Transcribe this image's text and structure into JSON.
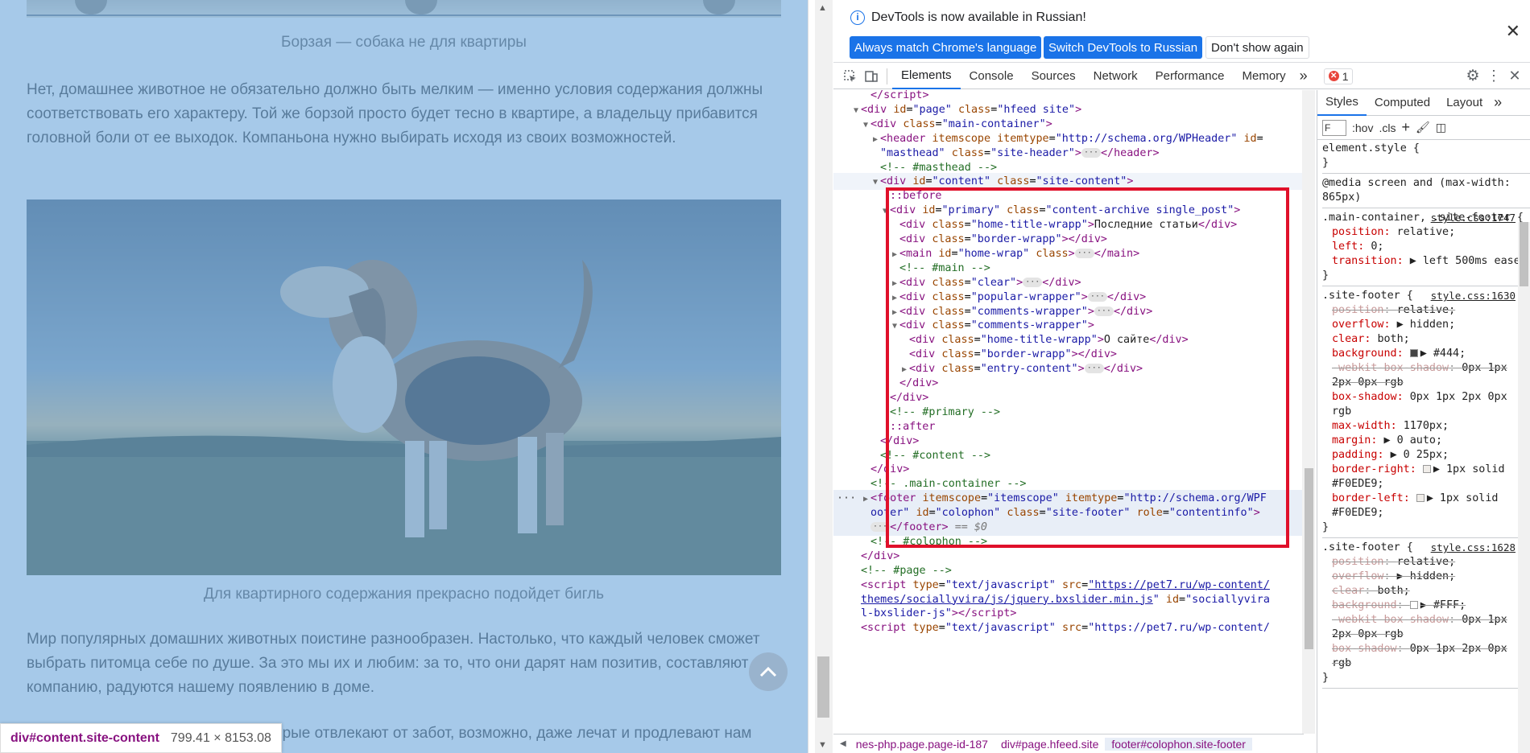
{
  "page": {
    "caption1": "Борзая — собака не для квартиры",
    "para1": "Нет, домашнее животное не обязательно должно быть мелким — именно условия содержания должны соответствовать его характеру. Той же борзой просто будет тесно в квартире, а владельцу прибавится головной боли от ее выходок. Компаньона нужно выбирать исходя из своих возможностей.",
    "caption2": "Для квартирного содержания прекрасно подойдет бигль",
    "para2": "Мир популярных домашних животных поистине разнообразен. Настолько, что каждый человек сможет выбрать питомца себе по душе. За это мы их и любим: за то, что они дарят нам позитив, составляют компанию, радуются нашему появлению в доме.",
    "para3_partial": "орые отвлекают от забот, возможно, даже лечат и продлевают нам",
    "tooltip_selector": "div#content.site-content",
    "tooltip_dims": "799.41 × 8153.08",
    "scroll_top_icon": "chevron-up-icon"
  },
  "infobar": {
    "message": "DevTools is now available in Russian!",
    "btn_match": "Always match Chrome's language",
    "btn_switch": "Switch DevTools to Russian",
    "btn_dismiss": "Don't show again",
    "close": "✕"
  },
  "tabs": [
    "Elements",
    "Console",
    "Sources",
    "Network",
    "Performance",
    "Memory"
  ],
  "more_tabs": "»",
  "error_count": "1",
  "elements_lines": [
    {
      "indent": 3,
      "html": "<span class='tag'>&lt;/script&gt;</span>"
    },
    {
      "indent": 2,
      "tri": "▼",
      "html": "<span class='tag'>&lt;div</span> <span class='attr'>id</span>=<span class='val'>\"page\"</span> <span class='attr'>class</span>=<span class='val'>\"hfeed site\"</span><span class='tag'>&gt;</span>"
    },
    {
      "indent": 3,
      "tri": "▼",
      "html": "<span class='tag'>&lt;div</span> <span class='attr'>class</span>=<span class='val'>\"main-container\"</span><span class='tag'>&gt;</span>"
    },
    {
      "indent": 4,
      "tri": "▶",
      "html": "<span class='tag'>&lt;header</span> <span class='attr'>itemscope</span> <span class='attr'>itemtype</span>=<span class='val'>\"http://schema.org/WPHeader\"</span> <span class='attr'>id</span>="
    },
    {
      "indent": 4,
      "html": "<span class='val'>\"masthead\"</span> <span class='attr'>class</span>=<span class='val'>\"site-header\"</span><span class='tag'>&gt;</span><span class='ell'>···</span><span class='tag'>&lt;/header&gt;</span>"
    },
    {
      "indent": 4,
      "html": "<span class='comment'>&lt;!-- #masthead --&gt;</span>"
    },
    {
      "indent": 4,
      "tri": "▼",
      "cls": "hov",
      "html": "<span class='tag'>&lt;div</span> <span class='attr'>id</span>=<span class='val'>\"content\"</span> <span class='attr'>class</span>=<span class='val'>\"site-content\"</span><span class='tag'>&gt;</span>"
    },
    {
      "indent": 5,
      "html": "<span class='pseudo'>::before</span>"
    },
    {
      "indent": 5,
      "tri": "▼",
      "html": "<span class='tag'>&lt;div</span> <span class='attr'>id</span>=<span class='val'>\"primary\"</span> <span class='attr'>class</span>=<span class='val'>\"content-archive single_post\"</span><span class='tag'>&gt;</span>"
    },
    {
      "indent": 6,
      "html": "<span class='tag'>&lt;div</span> <span class='attr'>class</span>=<span class='val'>\"home-title-wrapp\"</span><span class='tag'>&gt;</span><span class='txt'>Последние статьи</span><span class='tag'>&lt;/div&gt;</span>"
    },
    {
      "indent": 6,
      "html": "<span class='tag'>&lt;div</span> <span class='attr'>class</span>=<span class='val'>\"border-wrapp\"</span><span class='tag'>&gt;&lt;/div&gt;</span>"
    },
    {
      "indent": 6,
      "tri": "▶",
      "html": "<span class='tag'>&lt;main</span> <span class='attr'>id</span>=<span class='val'>\"home-wrap\"</span> <span class='attr'>class</span><span class='tag'>&gt;</span><span class='ell'>···</span><span class='tag'>&lt;/main&gt;</span>"
    },
    {
      "indent": 6,
      "html": "<span class='comment'>&lt;!-- #main --&gt;</span>"
    },
    {
      "indent": 6,
      "tri": "▶",
      "html": "<span class='tag'>&lt;div</span> <span class='attr'>class</span>=<span class='val'>\"clear\"</span><span class='tag'>&gt;</span><span class='ell'>···</span><span class='tag'>&lt;/div&gt;</span>"
    },
    {
      "indent": 6,
      "tri": "▶",
      "html": "<span class='tag'>&lt;div</span> <span class='attr'>class</span>=<span class='val'>\"popular-wrapper\"</span><span class='tag'>&gt;</span><span class='ell'>···</span><span class='tag'>&lt;/div&gt;</span>"
    },
    {
      "indent": 6,
      "tri": "▶",
      "html": "<span class='tag'>&lt;div</span> <span class='attr'>class</span>=<span class='val'>\"comments-wrapper\"</span><span class='tag'>&gt;</span><span class='ell'>···</span><span class='tag'>&lt;/div&gt;</span>"
    },
    {
      "indent": 6,
      "tri": "▼",
      "html": "<span class='tag'>&lt;div</span> <span class='attr'>class</span>=<span class='val'>\"comments-wrapper\"</span><span class='tag'>&gt;</span>"
    },
    {
      "indent": 7,
      "html": "<span class='tag'>&lt;div</span> <span class='attr'>class</span>=<span class='val'>\"home-title-wrapp\"</span><span class='tag'>&gt;</span><span class='txt'>О сайте</span><span class='tag'>&lt;/div&gt;</span>"
    },
    {
      "indent": 7,
      "html": "<span class='tag'>&lt;div</span> <span class='attr'>class</span>=<span class='val'>\"border-wrapp\"</span><span class='tag'>&gt;&lt;/div&gt;</span>"
    },
    {
      "indent": 7,
      "tri": "▶",
      "html": "<span class='tag'>&lt;div</span> <span class='attr'>class</span>=<span class='val'>\"entry-content\"</span><span class='tag'>&gt;</span><span class='ell'>···</span><span class='tag'>&lt;/div&gt;</span>"
    },
    {
      "indent": 6,
      "html": "<span class='tag'>&lt;/div&gt;</span>"
    },
    {
      "indent": 5,
      "html": "<span class='tag'>&lt;/div&gt;</span>"
    },
    {
      "indent": 5,
      "html": "<span class='comment'>&lt;!-- #primary --&gt;</span>"
    },
    {
      "indent": 5,
      "html": "<span class='pseudo'>::after</span>"
    },
    {
      "indent": 4,
      "html": "<span class='tag'>&lt;/div&gt;</span>"
    },
    {
      "indent": 4,
      "html": "<span class='comment'>&lt;!-- #content --&gt;</span>"
    },
    {
      "indent": 3,
      "html": "<span class='tag'>&lt;/div&gt;</span>"
    },
    {
      "indent": 3,
      "html": "<span class='comment'>&lt;!-- .main-container --&gt;</span>"
    },
    {
      "indent": 3,
      "tri": "▶",
      "cls": "sel",
      "dots": "···",
      "html": "<span class='tag'>&lt;footer</span> <span class='attr'>itemscope</span>=<span class='val'>\"itemscope\"</span> <span class='attr'>itemtype</span>=<span class='val'>\"http://schema.org/WPF</span>"
    },
    {
      "indent": 3,
      "cls": "sel",
      "html": "<span class='val'>ooter\"</span> <span class='attr'>id</span>=<span class='val'>\"colophon\"</span> <span class='attr'>class</span>=<span class='val'>\"site-footer\"</span> <span class='attr'>role</span>=<span class='val'>\"contentinfo\"</span><span class='tag'>&gt;</span>"
    },
    {
      "indent": 3,
      "cls": "sel",
      "html": "<span class='ell'>···</span><span class='tag'>&lt;/footer&gt;</span> <span style='color:#777;font-style:italic'>== $0</span>"
    },
    {
      "indent": 3,
      "html": "<span class='comment'>&lt;!-- #colophon --&gt;</span>"
    },
    {
      "indent": 2,
      "html": "<span class='tag'>&lt;/div&gt;</span>"
    },
    {
      "indent": 2,
      "html": "<span class='comment'>&lt;!-- #page --&gt;</span>"
    },
    {
      "indent": 2,
      "html": "<span class='tag'>&lt;script</span> <span class='attr'>type</span>=<span class='val'>\"text/javascript\"</span> <span class='attr'>src</span>=<span class='val' style='text-decoration:underline'>\"https://pet7.ru/wp-content/</span>"
    },
    {
      "indent": 2,
      "html": "<span class='val' style='text-decoration:underline'>themes/sociallyvira/js/jquery.bxslider.min.js</span><span class='val'>\"</span> <span class='attr'>id</span>=<span class='val'>\"sociallyvira</span>"
    },
    {
      "indent": 2,
      "html": "<span class='val'>l-bxslider-js\"</span><span class='tag'>&gt;&lt;/script&gt;</span>"
    },
    {
      "indent": 2,
      "html": "<span class='tag'>&lt;script</span> <span class='attr'>type</span>=<span class='val'>\"text/javascript\"</span> <span class='attr'>src</span>=<span class='val'>\"https://pet7.ru/wp-content/</span>"
    }
  ],
  "breadcrumbs": [
    {
      "label": "nes-php.page.page-id-187",
      "active": false
    },
    {
      "label": "div#page.hfeed.site",
      "active": false
    },
    {
      "label": "footer#colophon.site-footer",
      "active": true
    }
  ],
  "styles": {
    "tabs": [
      "Styles",
      "Computed",
      "Layout"
    ],
    "filter_placeholder": "F",
    "hov": ":hov",
    "cls": ".cls",
    "rules": [
      {
        "selector": "element.style {",
        "source": "",
        "lines": [
          "}"
        ]
      },
      {
        "selector": "@media screen and (max-width: 865px)",
        "source": "",
        "lines": []
      },
      {
        "selector": ".main-container, .site-footer {",
        "source": "style.css:1747",
        "props": [
          {
            "name": "position",
            "value": "relative;",
            "struck": false
          },
          {
            "name": "left",
            "value": "0;",
            "struck": false
          },
          {
            "name": "transition",
            "value": "▶ left 500ms ease;",
            "struck": false
          }
        ]
      },
      {
        "selector": ".site-footer {",
        "source": "style.css:1630",
        "props": [
          {
            "name": "position",
            "value": "relative;",
            "struck": true
          },
          {
            "name": "overflow",
            "value": "▶ hidden;",
            "struck": false
          },
          {
            "name": "clear",
            "value": "both;",
            "struck": false
          },
          {
            "name": "background",
            "value": "▶ #444;",
            "struck": false,
            "swatch": "#444444"
          },
          {
            "name": "-webkit-box-shadow",
            "value": "0px 1px 2px 0px rgb",
            "struck": true
          },
          {
            "name": "box-shadow",
            "value": "0px 1px 2px 0px rgb",
            "struck": false
          },
          {
            "name": "max-width",
            "value": "1170px;",
            "struck": false
          },
          {
            "name": "margin",
            "value": "▶ 0 auto;",
            "struck": false
          },
          {
            "name": "padding",
            "value": "▶ 0 25px;",
            "struck": false
          },
          {
            "name": "border-right",
            "value": "▶ 1px solid #F0EDE9;",
            "struck": false,
            "swatch": "#F0EDE9"
          },
          {
            "name": "border-left",
            "value": "▶ 1px solid #F0EDE9;",
            "struck": false,
            "swatch": "#F0EDE9"
          }
        ]
      },
      {
        "selector": ".site-footer {",
        "source": "style.css:1628",
        "props": [
          {
            "name": "position",
            "value": "relative;",
            "struck": true
          },
          {
            "name": "overflow",
            "value": "▶ hidden;",
            "struck": true
          },
          {
            "name": "clear",
            "value": "both;",
            "struck": true
          },
          {
            "name": "background",
            "value": "▶ #FFF;",
            "struck": true,
            "swatch": "#FFFFFF"
          },
          {
            "name": "-webkit-box-shadow",
            "value": "0px 1px 2px 0px rgb",
            "struck": true
          },
          {
            "name": "box-shadow",
            "value": "0px 1px 2px 0px rgb",
            "struck": true
          }
        ]
      }
    ]
  },
  "colors": {
    "accent": "#1a73e8",
    "highlight_box": "#e0102a",
    "overlay": "#6fa8dc"
  }
}
